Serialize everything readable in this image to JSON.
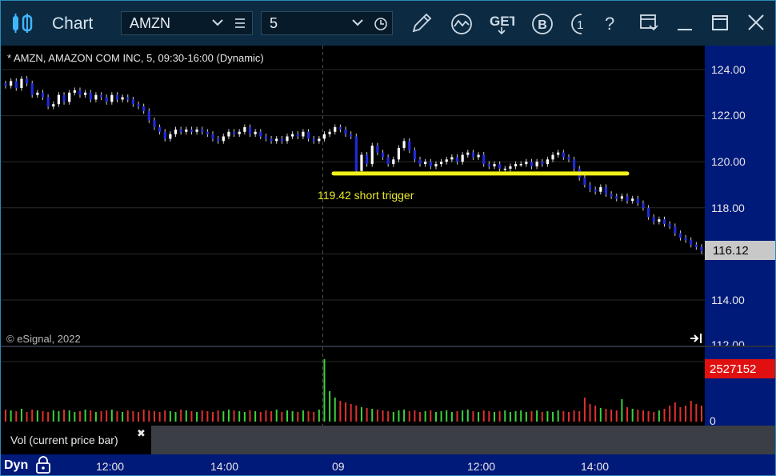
{
  "app": {
    "title": "Chart"
  },
  "toolbar": {
    "symbol": "AMZN",
    "interval": "5",
    "get_label": "GET",
    "b_label": "B",
    "partial_label": "1",
    "help_label": "?"
  },
  "chart": {
    "header": "* AMZN, AMAZON COM INC, 5, 09:30-16:00 (Dynamic)",
    "copyright": "© eSignal, 2022",
    "annotation": "119.42 short trigger",
    "last_price": "116.12",
    "price_ticks": [
      "124.00",
      "122.00",
      "120.00",
      "118.00",
      "116.00",
      "114.00",
      "112.00"
    ],
    "time_ticks": [
      "12:00",
      "14:00",
      "09",
      "12:00",
      "14:00"
    ]
  },
  "volume": {
    "last_value": "2527152",
    "zero_label": "0",
    "legend": "Vol (current price bar)",
    "close_label": "✖"
  },
  "footer": {
    "mode": "Dyn"
  },
  "chart_data": {
    "type": "candlestick",
    "symbol": "AMZN",
    "interval_minutes": 5,
    "ylim": [
      112,
      125
    ],
    "annotation": {
      "label": "119.42 short trigger",
      "value": 119.42
    },
    "last": 116.12,
    "closes": [
      123.3,
      123.5,
      123.2,
      123.6,
      123.4,
      122.9,
      123.0,
      122.8,
      122.4,
      122.5,
      122.9,
      122.6,
      123.0,
      123.1,
      122.9,
      123.0,
      122.7,
      122.9,
      122.8,
      122.6,
      122.9,
      122.7,
      122.8,
      122.7,
      122.5,
      122.4,
      122.2,
      121.8,
      121.5,
      121.3,
      121.0,
      121.2,
      121.4,
      121.3,
      121.4,
      121.3,
      121.4,
      121.3,
      121.2,
      121.0,
      120.9,
      121.1,
      121.3,
      121.2,
      121.3,
      121.5,
      121.2,
      121.3,
      121.1,
      121.0,
      120.9,
      121.0,
      120.9,
      121.1,
      121.2,
      121.1,
      121.3,
      121.0,
      120.9,
      121.0,
      121.2,
      121.3,
      121.5,
      121.4,
      121.2,
      121.1,
      119.6,
      120.3,
      119.9,
      120.7,
      120.4,
      120.2,
      119.9,
      120.1,
      120.6,
      120.9,
      120.5,
      120.1,
      119.9,
      120.0,
      119.8,
      119.9,
      120.0,
      120.1,
      120.2,
      120.0,
      120.3,
      120.4,
      120.2,
      120.3,
      119.9,
      119.8,
      119.9,
      119.7,
      119.7,
      119.8,
      119.9,
      119.9,
      120.0,
      119.8,
      120.0,
      119.9,
      120.1,
      120.3,
      120.4,
      120.2,
      120.1,
      119.7,
      119.3,
      119.0,
      118.8,
      118.7,
      118.9,
      118.6,
      118.5,
      118.4,
      118.5,
      118.3,
      118.4,
      118.2,
      118.0,
      117.6,
      117.4,
      117.5,
      117.3,
      117.2,
      116.9,
      116.7,
      116.6,
      116.4,
      116.3,
      116.12
    ],
    "volumes": [
      15,
      14,
      13,
      16,
      12,
      15,
      14,
      13,
      12,
      14,
      13,
      15,
      14,
      12,
      13,
      15,
      14,
      12,
      13,
      14,
      15,
      13,
      12,
      14,
      13,
      12,
      15,
      14,
      13,
      12,
      14,
      13,
      12,
      15,
      14,
      13,
      12,
      14,
      13,
      12,
      14,
      13,
      15,
      14,
      13,
      12,
      14,
      13,
      12,
      14,
      13,
      15,
      12,
      14,
      13,
      12,
      14,
      13,
      12,
      15,
      78,
      38,
      30,
      26,
      24,
      22,
      20,
      18,
      17,
      16,
      15,
      14,
      13,
      12,
      14,
      15,
      13,
      14,
      12,
      13,
      14,
      12,
      13,
      14,
      12,
      13,
      14,
      15,
      13,
      12,
      14,
      13,
      12,
      13,
      14,
      12,
      13,
      14,
      12,
      13,
      14,
      12,
      13,
      12,
      14,
      13,
      12,
      14,
      13,
      30,
      22,
      20,
      17,
      16,
      15,
      14,
      28,
      18,
      16,
      15,
      14,
      13,
      12,
      14,
      16,
      20,
      24,
      18,
      20,
      26,
      22,
      20,
      18,
      25,
      30,
      60
    ]
  }
}
